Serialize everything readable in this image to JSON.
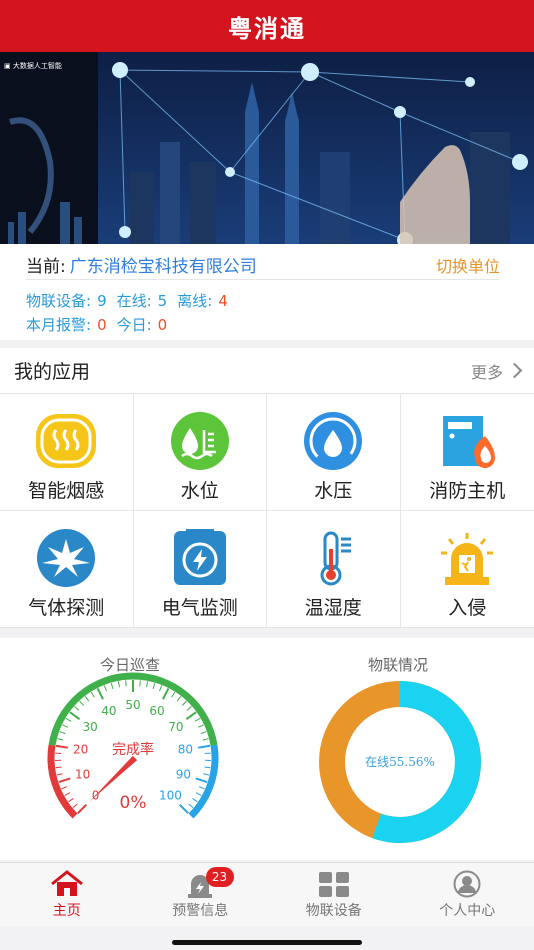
{
  "header": {
    "title": "粤消通"
  },
  "info": {
    "current_label": "当前:",
    "company": "广东消检宝科技有限公司",
    "switch_label": "切换单位",
    "devices_label": "物联设备:",
    "devices_value": "9",
    "online_label": "在线:",
    "online_value": "5",
    "offline_label": "离线:",
    "offline_value": "4",
    "month_alarm_label": "本月报警:",
    "month_alarm_value": "0",
    "today_label": "今日:",
    "today_value": "0"
  },
  "apps": {
    "title": "我的应用",
    "more_label": "更多",
    "items": [
      {
        "label": "智能烟感",
        "icon": "smoke-detector-icon",
        "color": "#f5c518"
      },
      {
        "label": "水位",
        "icon": "water-level-icon",
        "color": "#5cc53a"
      },
      {
        "label": "水压",
        "icon": "water-pressure-icon",
        "color": "#2f8fe0"
      },
      {
        "label": "消防主机",
        "icon": "fire-host-icon",
        "color": "#2aa3e0"
      },
      {
        "label": "气体探测",
        "icon": "gas-detect-icon",
        "color": "#2a88c8"
      },
      {
        "label": "电气监测",
        "icon": "electric-monitor-icon",
        "color": "#2a88c8"
      },
      {
        "label": "温湿度",
        "icon": "thermometer-icon",
        "color": "#2a88c8"
      },
      {
        "label": "入侵",
        "icon": "intrusion-alarm-icon",
        "color": "#f5b518"
      }
    ]
  },
  "stats": {
    "patrol_title": "今日巡查",
    "iot_title": "物联情况",
    "gauge_label": "完成率",
    "gauge_value_text": "0%",
    "gauge_value": 0,
    "gauge_ticks": [
      "0",
      "10",
      "20",
      "30",
      "40",
      "50",
      "60",
      "70",
      "80",
      "90",
      "100"
    ],
    "donut_label": "在线55.56%",
    "donut_online_fraction": 0.5556,
    "donut_online_color": "#19d3f0",
    "donut_offline_color": "#e8962a"
  },
  "tabbar": {
    "items": [
      {
        "label": "主页",
        "icon": "home-icon",
        "active": true
      },
      {
        "label": "预警信息",
        "icon": "alarm-icon",
        "active": false,
        "badge": "23"
      },
      {
        "label": "物联设备",
        "icon": "grid-icon",
        "active": false
      },
      {
        "label": "个人中心",
        "icon": "user-icon",
        "active": false
      }
    ]
  },
  "colors": {
    "brand_red": "#d4141d",
    "link_blue": "#2f7fe0",
    "accent_orange": "#e8942a"
  }
}
